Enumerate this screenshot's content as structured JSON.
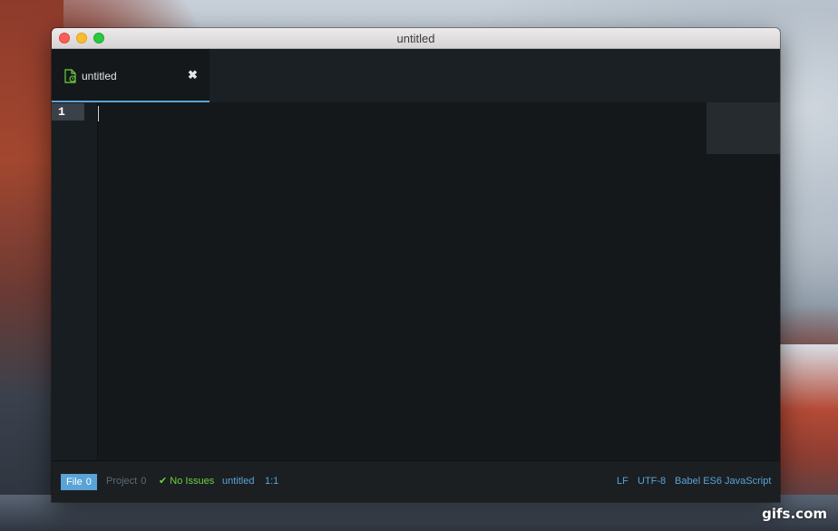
{
  "window": {
    "title": "untitled"
  },
  "tabs": [
    {
      "label": "untitled",
      "close": "✖"
    }
  ],
  "editor": {
    "active_line_number": "1"
  },
  "statusbar": {
    "file_label": "File",
    "file_count": "0",
    "project_label": "Project",
    "project_count": "0",
    "lint_check": "✔",
    "lint_status": "No Issues",
    "filename": "untitled",
    "cursor_position": "1:1",
    "line_ending": "LF",
    "encoding": "UTF-8",
    "grammar": "Babel ES6 JavaScript"
  },
  "watermark": "gifs.com",
  "colors": {
    "accent": "#5aa3d6",
    "success": "#6fcf3f",
    "editor_bg": "#14181b"
  }
}
